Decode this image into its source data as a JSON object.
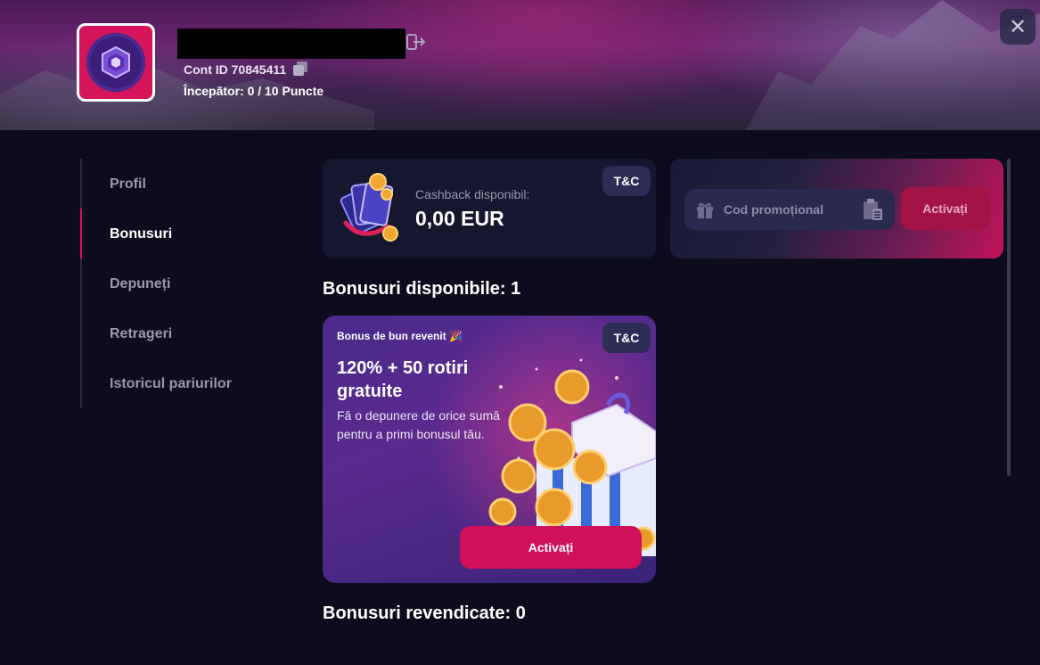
{
  "header": {
    "account_id_label": "Cont ID 70845411",
    "level_text": "Începător: 0  / 10 Puncte",
    "close_symbol": "✕"
  },
  "sidebar": {
    "items": [
      {
        "label": "Profil",
        "active": false
      },
      {
        "label": "Bonusuri",
        "active": true
      },
      {
        "label": "Depuneți",
        "active": false
      },
      {
        "label": "Retrageri",
        "active": false
      },
      {
        "label": "Istoricul pariurilor",
        "active": false
      }
    ]
  },
  "cashback": {
    "label": "Cashback disponibil:",
    "value": "0,00 EUR",
    "tc_label": "T&C"
  },
  "promo": {
    "placeholder": "Cod promoțional",
    "activate_label": "Activați"
  },
  "available_title": "Bonusuri disponibile: 1",
  "bonus": {
    "eyebrow": "Bonus de bun revenit 🎉",
    "title": "120% + 50 rotiri gratuite",
    "description": "Fă o depunere de orice sumă pentru a primi bonusul tău.",
    "tc_label": "T&C",
    "activate_label": "Activați"
  },
  "claimed_title": "Bonusuri revendicate: 0",
  "colors": {
    "accent": "#d0105a",
    "background": "#0c0c1e",
    "card": "#16162e"
  }
}
